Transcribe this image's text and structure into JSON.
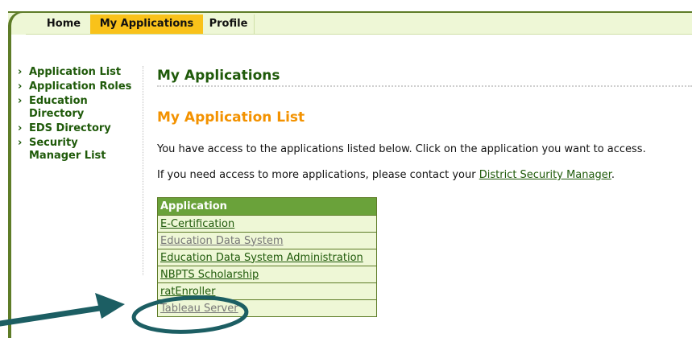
{
  "nav": {
    "tabs": [
      {
        "label": "Home"
      },
      {
        "label": "My Applications"
      },
      {
        "label": "Profile"
      }
    ]
  },
  "sidebar": {
    "items": [
      {
        "label": "Application List"
      },
      {
        "label": "Application Roles"
      },
      {
        "label": "Education Directory"
      },
      {
        "label": "EDS Directory"
      },
      {
        "label": "Security Manager List"
      }
    ]
  },
  "main": {
    "page_title": "My Applications",
    "section_title": "My Application List",
    "intro": "You have access to the applications listed below. Click on the application you want to access.",
    "contact_prefix": "If you need access to more applications, please contact your ",
    "contact_link": "District Security Manager",
    "contact_suffix": ".",
    "table": {
      "header": "Application",
      "rows": [
        {
          "label": "E-Certification",
          "state": "active"
        },
        {
          "label": "Education Data System",
          "state": "inactive"
        },
        {
          "label": "Education Data System Administration",
          "state": "active"
        },
        {
          "label": "NBPTS Scholarship",
          "state": "active"
        },
        {
          "label": "ratEnroller",
          "state": "active"
        },
        {
          "label": "Tableau Server",
          "state": "inactive"
        }
      ]
    }
  },
  "colors": {
    "brand_green": "#1f5a0a",
    "accent_orange": "#f39200",
    "tab_active": "#f9c21a",
    "annotation": "#1c5e63"
  }
}
